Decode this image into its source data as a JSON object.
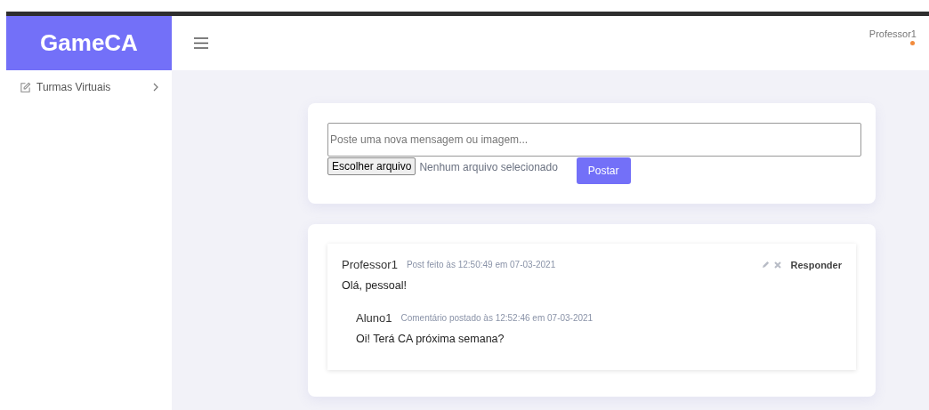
{
  "brand": "GameCA",
  "sidebar": {
    "items": [
      {
        "label": "Turmas Virtuais",
        "expanded": false
      }
    ]
  },
  "user": {
    "name": "Professor1",
    "color": "#f28b3c"
  },
  "composer": {
    "placeholder": "Poste uma nova mensagem ou imagem...",
    "file_button": "Escolher arquivo",
    "file_status": "Nenhum arquivo selecionado",
    "submit": "Postar"
  },
  "posts": [
    {
      "author": "Professor1",
      "meta": "Post feito às 12:50:49 em 07-03-2021",
      "text": "Olá, pessoal!",
      "reply": "Responder",
      "comments": [
        {
          "author": "Aluno1",
          "meta": "Comentário postado às 12:52:46 em 07-03-2021",
          "text": "Oi! Terá CA próxima semana?"
        }
      ]
    }
  ]
}
